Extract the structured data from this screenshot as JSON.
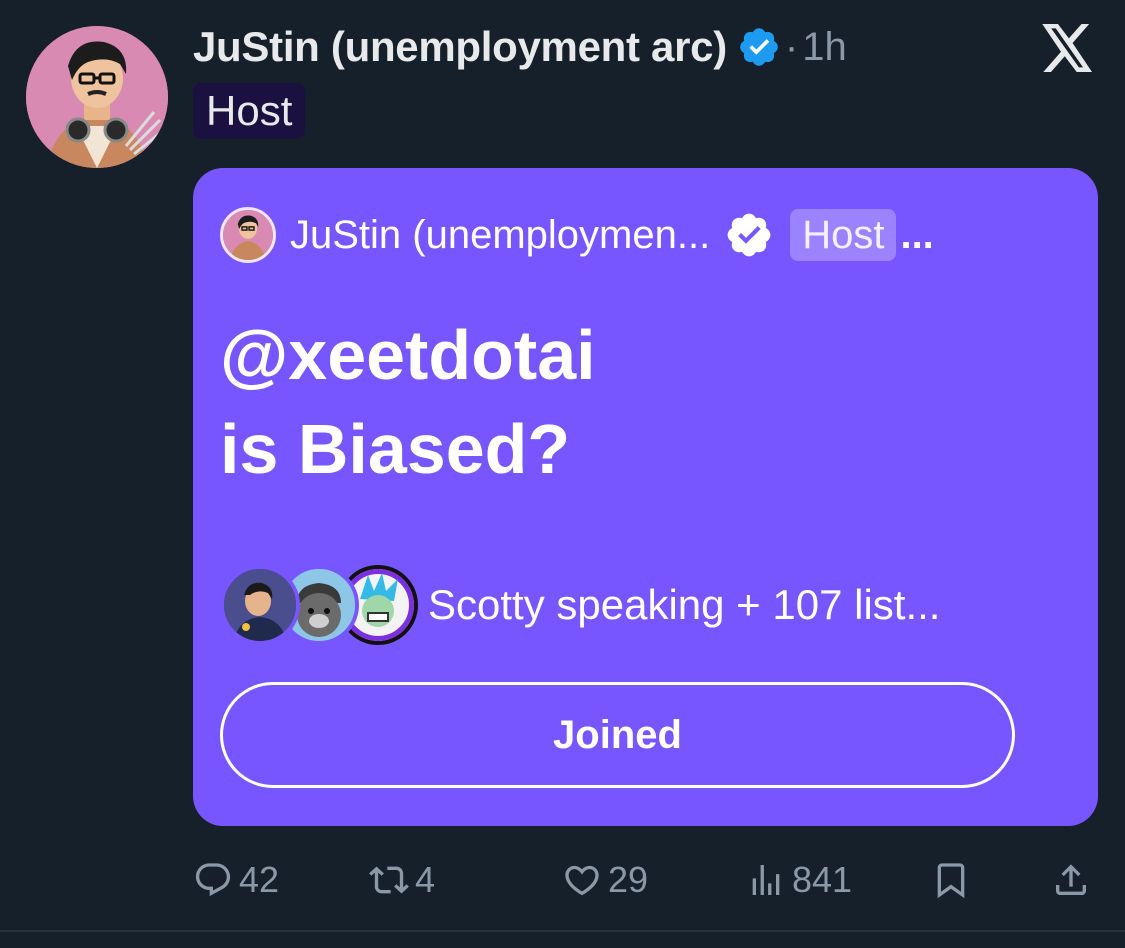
{
  "tweet": {
    "author_name": "JuStin (unemployment arc)",
    "separator": "·",
    "time": "1h",
    "host_label": "Host"
  },
  "space_card": {
    "host_name": "JuStin (unemploymen...",
    "host_label": "Host",
    "overflow": "...",
    "title_line1": "@xeetdotai",
    "title_line2": "is Biased?",
    "participants_summary": "Scotty speaking + 107 list...",
    "joined_label": "Joined",
    "background_color": "#7856ff"
  },
  "actions": {
    "replies": "42",
    "retweets": "4",
    "likes": "29",
    "views": "841"
  },
  "icons": [
    "verified-badge-icon",
    "x-logo-icon",
    "reply-icon",
    "retweet-icon",
    "like-icon",
    "views-icon",
    "bookmark-icon",
    "share-icon"
  ]
}
